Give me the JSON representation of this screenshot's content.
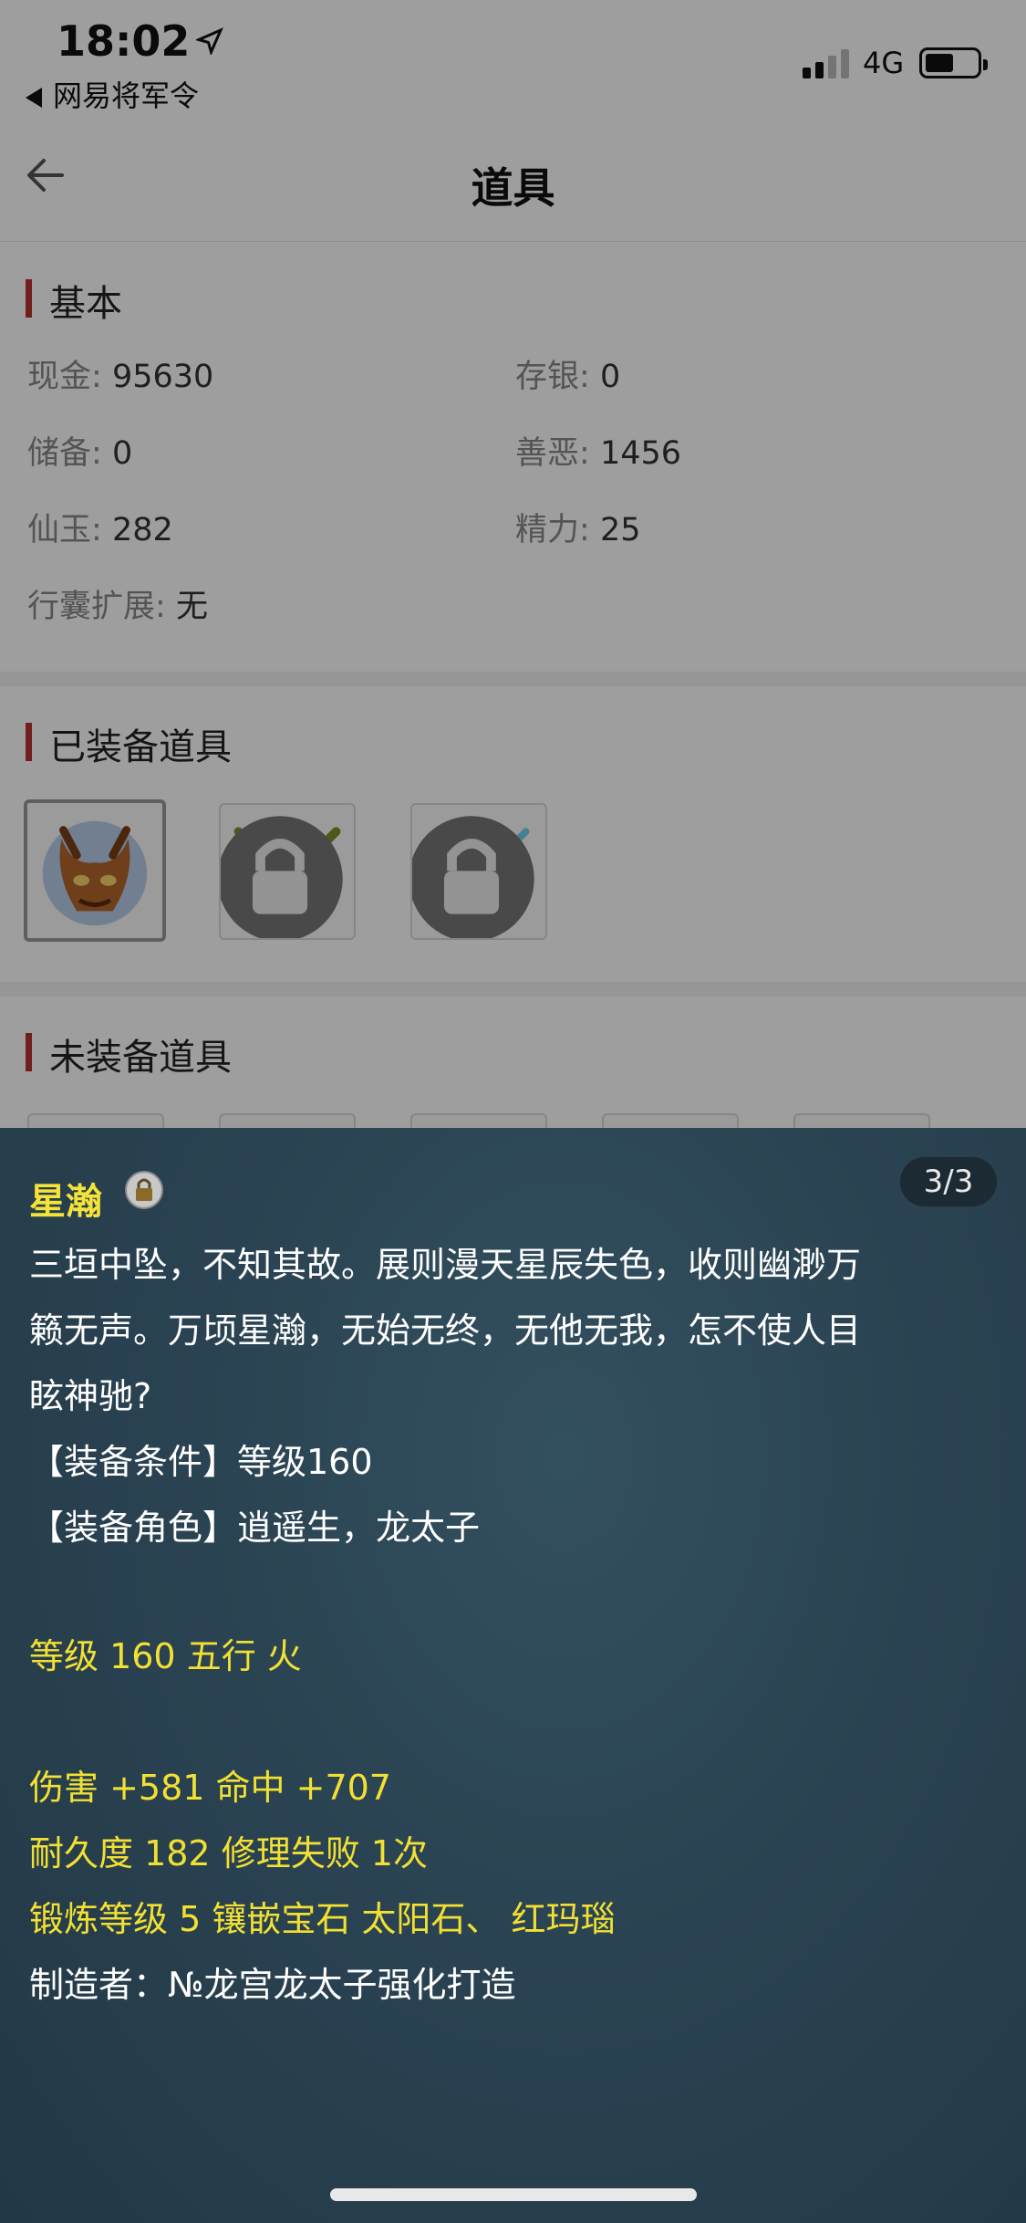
{
  "status_bar": {
    "time": "18:02",
    "back_app_label": "网易将军令",
    "network": "4G"
  },
  "nav": {
    "title": "道具"
  },
  "basic": {
    "title": "基本",
    "fields": [
      {
        "label": "现金:",
        "value": "95630"
      },
      {
        "label": "存银:",
        "value": "0"
      },
      {
        "label": "储备:",
        "value": "0"
      },
      {
        "label": "善恶:",
        "value": "1456"
      },
      {
        "label": "仙玉:",
        "value": "282"
      },
      {
        "label": "精力:",
        "value": "25"
      },
      {
        "label": "行囊扩展:",
        "value": "无"
      }
    ]
  },
  "equipped": {
    "title": "已装备道具",
    "items": [
      {
        "icon": "demon-mask-helmet-icon",
        "locked": false,
        "selected": true
      },
      {
        "icon": "golden-armor-icon",
        "locked": true,
        "selected": false
      },
      {
        "icon": "star-fan-weapon-icon",
        "locked": true,
        "selected": false
      }
    ]
  },
  "unequipped": {
    "title": "未装备道具"
  },
  "detail": {
    "name": "星瀚",
    "page": "3/3",
    "description_lines": [
      "三垣中坠，不知其故。展则漫天星辰失色，收则幽渺万",
      "籁无声。万顷星瀚，无始无终，无他无我，怎不使人目",
      "眩神驰?",
      "【装备条件】等级160",
      "【装备角色】逍遥生，龙太子"
    ],
    "level_line": "等级 160 五行 火",
    "damage_line": "伤害 +581 命中 +707",
    "durability_line": "耐久度 182 修理失败 1次",
    "forge_line": "锻炼等级 5 镶嵌宝石 太阳石、 红玛瑙",
    "maker_line": "制造者：№龙宫龙太子强化打造"
  },
  "colors": {
    "accent_bar": "#b8312f",
    "panel_bg": "#2a4352",
    "highlight_text": "#f2e033"
  }
}
